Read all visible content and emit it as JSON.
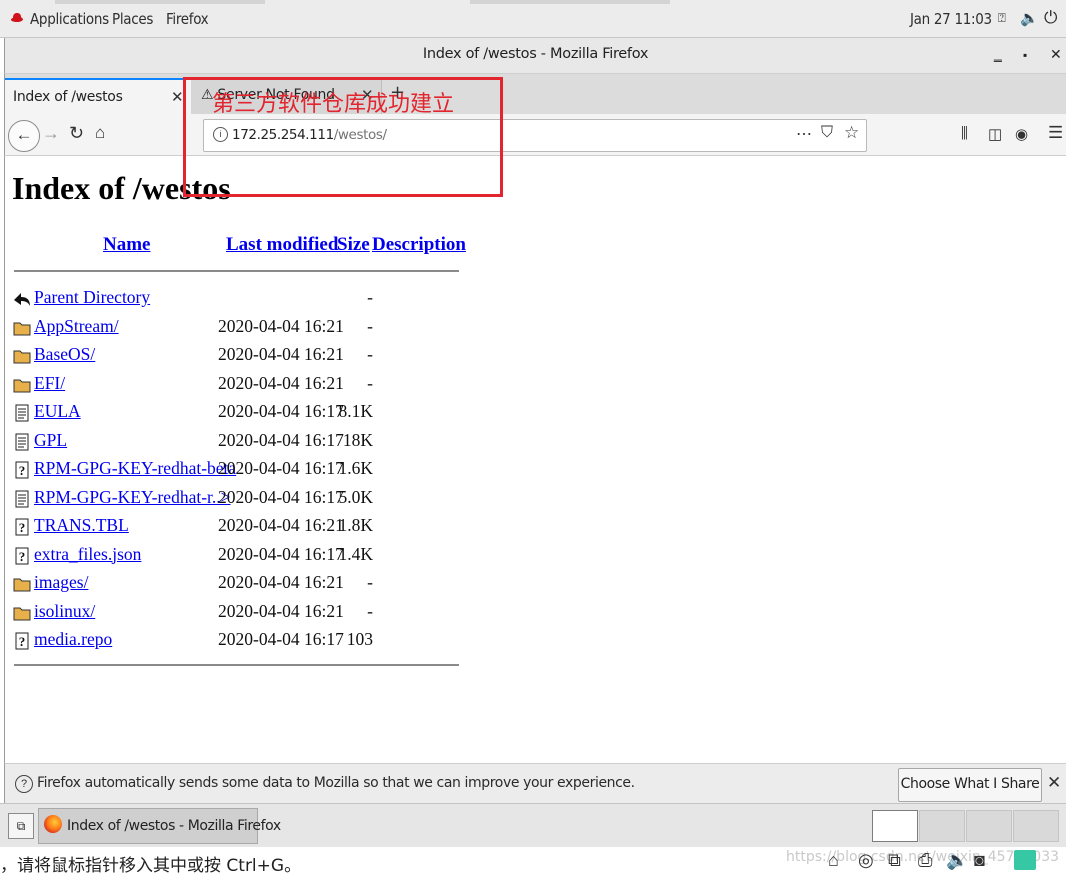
{
  "topbar": {
    "applications": "Applications",
    "places": "Places",
    "firefox": "Firefox",
    "datetime": "Jan 27  11:03"
  },
  "window": {
    "title": "Index of /westos - Mozilla Firefox"
  },
  "tabs": [
    {
      "label": "Index of /westos"
    },
    {
      "label": "Server Not Found"
    }
  ],
  "nav": {
    "url_host": "172.25.254.111",
    "url_path": "/westos/"
  },
  "page": {
    "title": "Index of /westos",
    "columns": {
      "name": "Name",
      "modified": "Last modified",
      "size": "Size",
      "description": "Description"
    },
    "rows": [
      {
        "icon": "back-icon",
        "name": "Parent Directory",
        "modified": "",
        "size": "-"
      },
      {
        "icon": "folder-icon",
        "name": "AppStream/",
        "modified": "2020-04-04 16:21",
        "size": "-"
      },
      {
        "icon": "folder-icon",
        "name": "BaseOS/",
        "modified": "2020-04-04 16:21",
        "size": "-"
      },
      {
        "icon": "folder-icon",
        "name": "EFI/",
        "modified": "2020-04-04 16:21",
        "size": "-"
      },
      {
        "icon": "text-file-icon",
        "name": "EULA",
        "modified": "2020-04-04 16:17",
        "size": "8.1K"
      },
      {
        "icon": "text-file-icon",
        "name": "GPL",
        "modified": "2020-04-04 16:17",
        "size": "18K"
      },
      {
        "icon": "unknown-file-icon",
        "name": "RPM-GPG-KEY-redhat-beta",
        "modified": "2020-04-04 16:17",
        "size": "1.6K"
      },
      {
        "icon": "text-file-icon",
        "name": "RPM-GPG-KEY-redhat-r..>",
        "modified": "2020-04-04 16:17",
        "size": "5.0K"
      },
      {
        "icon": "unknown-file-icon",
        "name": "TRANS.TBL",
        "modified": "2020-04-04 16:21",
        "size": "1.8K"
      },
      {
        "icon": "unknown-file-icon",
        "name": "extra_files.json",
        "modified": "2020-04-04 16:17",
        "size": "1.4K"
      },
      {
        "icon": "folder-icon",
        "name": "images/",
        "modified": "2020-04-04 16:21",
        "size": "-"
      },
      {
        "icon": "folder-icon",
        "name": "isolinux/",
        "modified": "2020-04-04 16:21",
        "size": "-"
      },
      {
        "icon": "unknown-file-icon",
        "name": "media.repo",
        "modified": "2020-04-04 16:17",
        "size": "103"
      }
    ]
  },
  "annotation": {
    "text": "第三方软件仓库成功建立",
    "color": "#e2252e"
  },
  "notification": {
    "text": "Firefox automatically sends some data to Mozilla so that we can improve your experience.",
    "button": "Choose What I Share"
  },
  "taskbar": {
    "task_label": "Index of /westos - Mozilla Firefox"
  },
  "status": {
    "text": "，请将鼠标指针移入其中或按 Ctrl+G。",
    "watermark": "https://blog.csdn.net/weixin_45711033"
  },
  "colors": {
    "link": "#0000ee",
    "tab_accent": "#0a84ff"
  }
}
